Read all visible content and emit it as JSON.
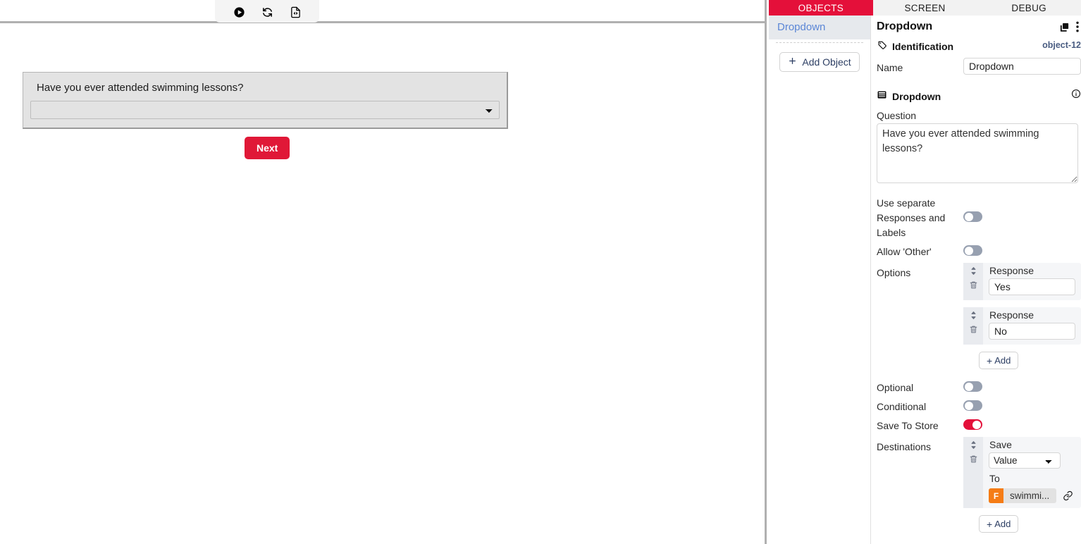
{
  "preview": {
    "toolbar": [
      {
        "name": "play-icon",
        "label": "Play"
      },
      {
        "name": "refresh-icon",
        "label": "Refresh"
      },
      {
        "name": "code-file-icon",
        "label": "View Source"
      }
    ],
    "form": {
      "question": "Have you ever attended swimming lessons?",
      "select_value": "",
      "next_label": "Next"
    }
  },
  "editor": {
    "tabs": [
      {
        "label": "OBJECTS",
        "active": true
      },
      {
        "label": "SCREEN",
        "active": false
      },
      {
        "label": "DEBUG",
        "active": false
      }
    ],
    "object_list": {
      "items": [
        {
          "label": "Dropdown",
          "selected": true
        }
      ],
      "add_label": "Add Object"
    },
    "panel": {
      "title": "Dropdown",
      "identification": {
        "section_label": "Identification",
        "object_id": "object-12",
        "name_label": "Name",
        "name_value": "Dropdown"
      },
      "dropdown": {
        "section_label": "Dropdown",
        "question_label": "Question",
        "question_value": "Have you ever attended swimming lessons?",
        "use_separate_label": "Use separate Responses and Labels",
        "use_separate_on": false,
        "allow_other_label": "Allow 'Other'",
        "allow_other_on": false,
        "options_label": "Options",
        "options": [
          {
            "caption": "Response",
            "value": "Yes"
          },
          {
            "caption": "Response",
            "value": "No"
          }
        ],
        "options_add_label": "Add",
        "optional_label": "Optional",
        "optional_on": false,
        "conditional_label": "Conditional",
        "conditional_on": false,
        "save_to_store_label": "Save To Store",
        "save_to_store_on": true,
        "destinations_label": "Destinations",
        "destinations": [
          {
            "save_caption": "Save",
            "save_value": "Value",
            "save_options": [
              "Value"
            ],
            "to_caption": "To",
            "chip_badge": "F",
            "chip_text": "swimmi..."
          }
        ],
        "destinations_add_label": "Add"
      }
    }
  },
  "colors": {
    "accent_red": "#e4103a",
    "button_red": "#e01837",
    "toggle_off": "#97a0b0",
    "chip_orange": "#f57c16",
    "link_blue": "#5b86d6"
  }
}
